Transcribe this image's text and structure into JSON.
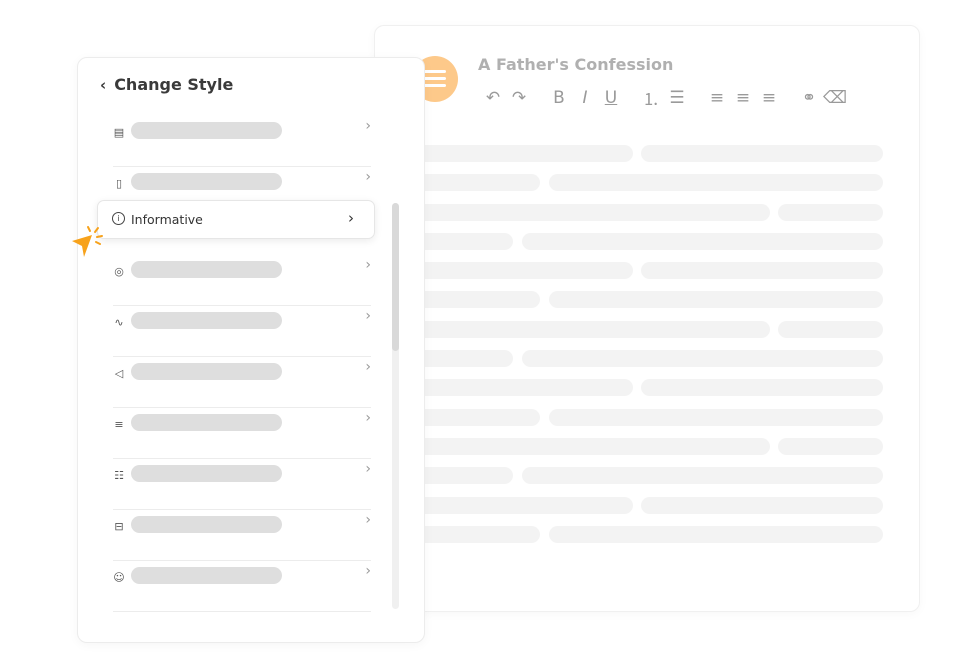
{
  "document": {
    "title": "A Father's Confession",
    "toolbar": [
      {
        "icon": "undo-icon",
        "glyph": "↶"
      },
      {
        "icon": "redo-icon",
        "glyph": "↷"
      },
      {
        "icon": "bold-icon",
        "glyph": "B"
      },
      {
        "icon": "italic-icon",
        "glyph": "I"
      },
      {
        "icon": "underline-icon",
        "glyph": "U"
      },
      {
        "icon": "numbered-list-icon",
        "glyph": "⒈"
      },
      {
        "icon": "bullet-list-icon",
        "glyph": "☰"
      },
      {
        "icon": "align-left-icon",
        "glyph": "≡"
      },
      {
        "icon": "align-center-icon",
        "glyph": "≡"
      },
      {
        "icon": "align-right-icon",
        "glyph": "≡"
      },
      {
        "icon": "link-icon",
        "glyph": "⚭"
      },
      {
        "icon": "eraser-icon",
        "glyph": "⌫"
      }
    ]
  },
  "panel": {
    "title": "Change Style",
    "back_icon": "chevron-left-icon",
    "selected": {
      "label": "Informative",
      "icon": "info-icon"
    },
    "items": [
      {
        "icon": "document-icon",
        "glyph": "▤"
      },
      {
        "icon": "tie-icon",
        "glyph": "▯"
      },
      {
        "icon": "cursor-click-icon",
        "glyph": "◎"
      },
      {
        "icon": "waveform-icon",
        "glyph": "∿"
      },
      {
        "icon": "megaphone-icon",
        "glyph": "◁"
      },
      {
        "icon": "lines-icon",
        "glyph": "≡"
      },
      {
        "icon": "list-icon",
        "glyph": "☷"
      },
      {
        "icon": "briefcase-icon",
        "glyph": "⊟"
      },
      {
        "icon": "smiley-icon",
        "glyph": "☺"
      }
    ]
  },
  "colors": {
    "accent": "#f7a21b",
    "menu_circle": "#fdc98a"
  }
}
